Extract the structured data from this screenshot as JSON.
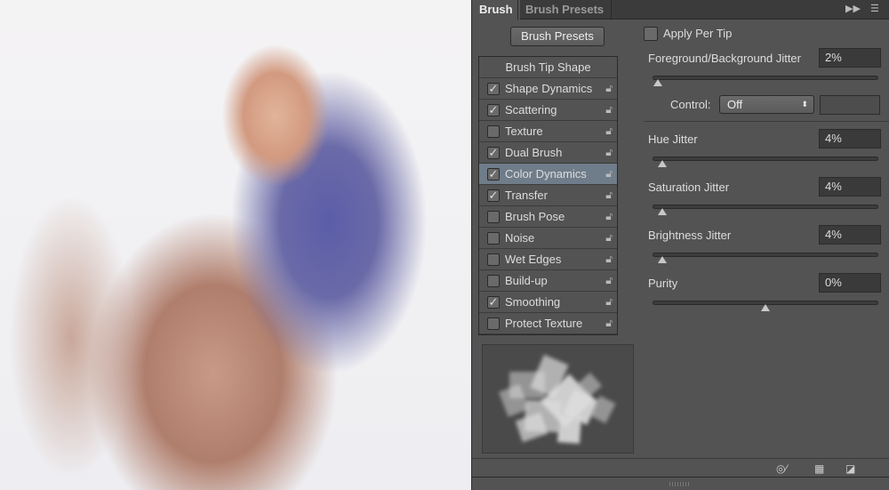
{
  "tabs": [
    {
      "label": "Brush"
    },
    {
      "label": "Brush Presets"
    }
  ],
  "brush_presets_button": "Brush Presets",
  "list": {
    "header": "Brush Tip Shape",
    "items": [
      {
        "label": "Shape Dynamics",
        "checked": true
      },
      {
        "label": "Scattering",
        "checked": true
      },
      {
        "label": "Texture",
        "checked": false
      },
      {
        "label": "Dual Brush",
        "checked": true
      },
      {
        "label": "Color Dynamics",
        "checked": true,
        "selected": true
      },
      {
        "label": "Transfer",
        "checked": true
      },
      {
        "label": "Brush Pose",
        "checked": false
      },
      {
        "label": "Noise",
        "checked": false
      },
      {
        "label": "Wet Edges",
        "checked": false
      },
      {
        "label": "Build-up",
        "checked": false
      },
      {
        "label": "Smoothing",
        "checked": true
      },
      {
        "label": "Protect Texture",
        "checked": false
      }
    ]
  },
  "apply_per_tip": {
    "label": "Apply Per Tip",
    "checked": false
  },
  "fg_bg_jitter": {
    "label": "Foreground/Background Jitter",
    "value": "2%",
    "percent": 2
  },
  "control": {
    "label": "Control:",
    "value": "Off"
  },
  "hue_jitter": {
    "label": "Hue Jitter",
    "value": "4%",
    "percent": 4
  },
  "saturation_jitter": {
    "label": "Saturation Jitter",
    "value": "4%",
    "percent": 4
  },
  "brightness_jitter": {
    "label": "Brightness Jitter",
    "value": "4%",
    "percent": 4
  },
  "purity": {
    "label": "Purity",
    "value": "0%",
    "percent": 0,
    "range": [
      -100,
      100
    ]
  },
  "check_glyph": "✓",
  "icons": {
    "lock": "lock-icon",
    "toggle_preview": "eye-brush-icon",
    "grid": "grid-icon",
    "new": "new-preset-icon"
  }
}
